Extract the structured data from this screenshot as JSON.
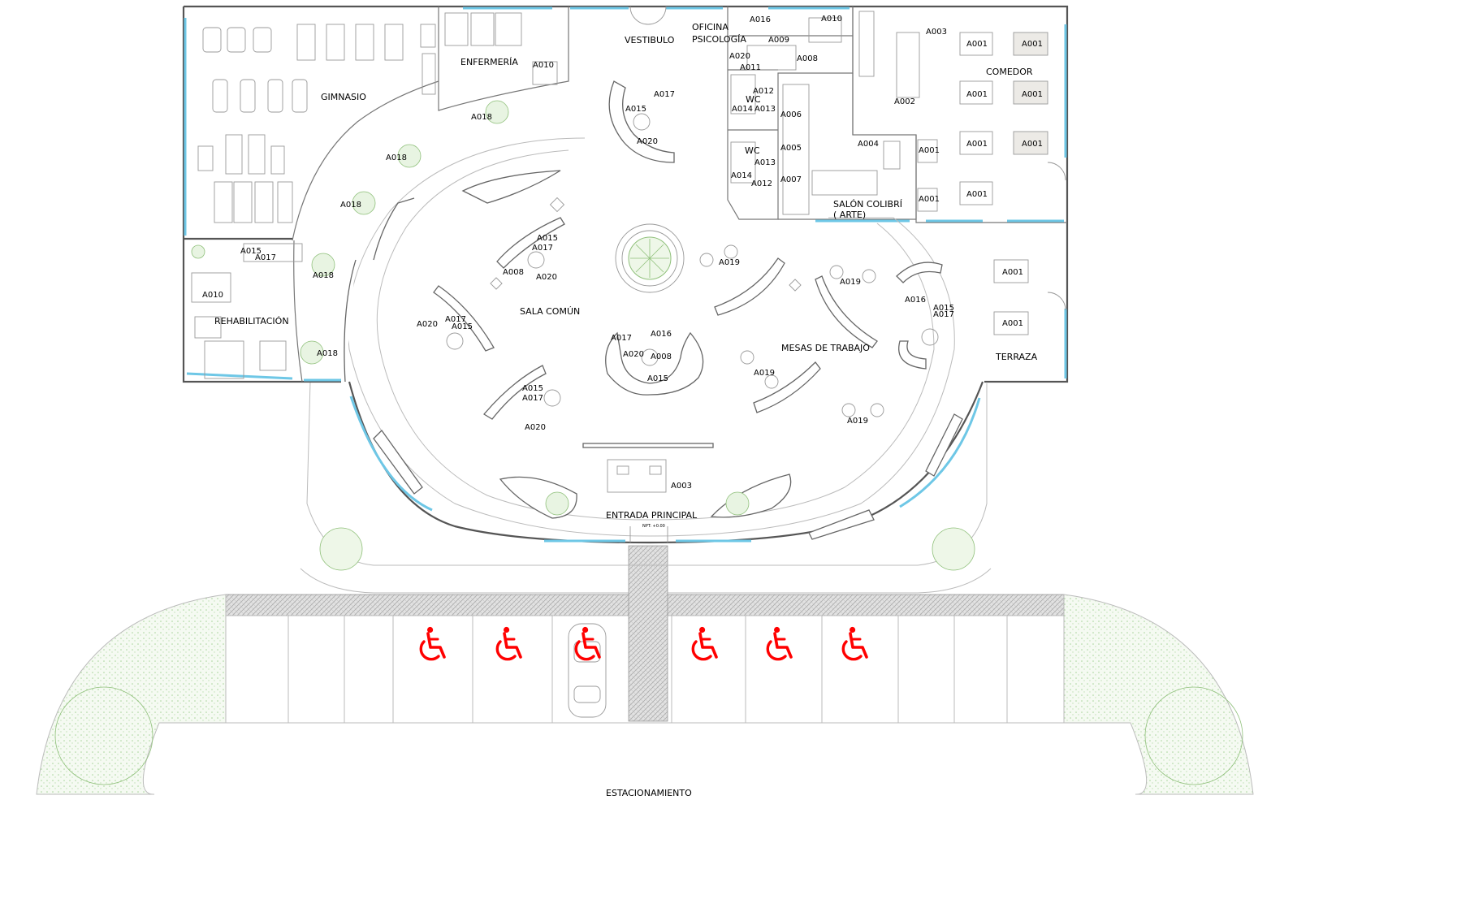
{
  "rooms": {
    "gimnasio": "GIMNASIO",
    "enfermeria": "ENFERMERÍA",
    "vestibulo": "VESTIBULO",
    "oficina_1": "OFICINA",
    "oficina_2": "PSICOLOGÍA",
    "comedor": "COMEDOR",
    "wc": "WC",
    "salon_1": "SALÓN COLIBRÍ",
    "salon_2": "( ARTE)",
    "rehabilitacion": "REHABILITACIÓN",
    "sala_comun": "SALA COMÚN",
    "mesas_trabajo": "MESAS DE TRABAJO",
    "terraza": "TERRAZA",
    "entrada_principal": "ENTRADA PRINCIPAL",
    "estacionamiento": "ESTACIONAMIENTO",
    "npt": "NPT: +0.00"
  },
  "codes": {
    "a001": "A001",
    "a002": "A002",
    "a003": "A003",
    "a004": "A004",
    "a005": "A005",
    "a006": "A006",
    "a007": "A007",
    "a008": "A008",
    "a009": "A009",
    "a010": "A010",
    "a011": "A011",
    "a012": "A012",
    "a013": "A013",
    "a014": "A014",
    "a015": "A015",
    "a016": "A016",
    "a017": "A017",
    "a018": "A018",
    "a019": "A019",
    "a020": "A020"
  },
  "colors": {
    "glazing": "#6ec7e6",
    "accessible_symbol": "#ff0000",
    "vegetation": "#8fc07a"
  },
  "icons": {
    "accessible_parking": "wheelchair-icon",
    "tree": "tree-icon",
    "car": "car-icon"
  }
}
